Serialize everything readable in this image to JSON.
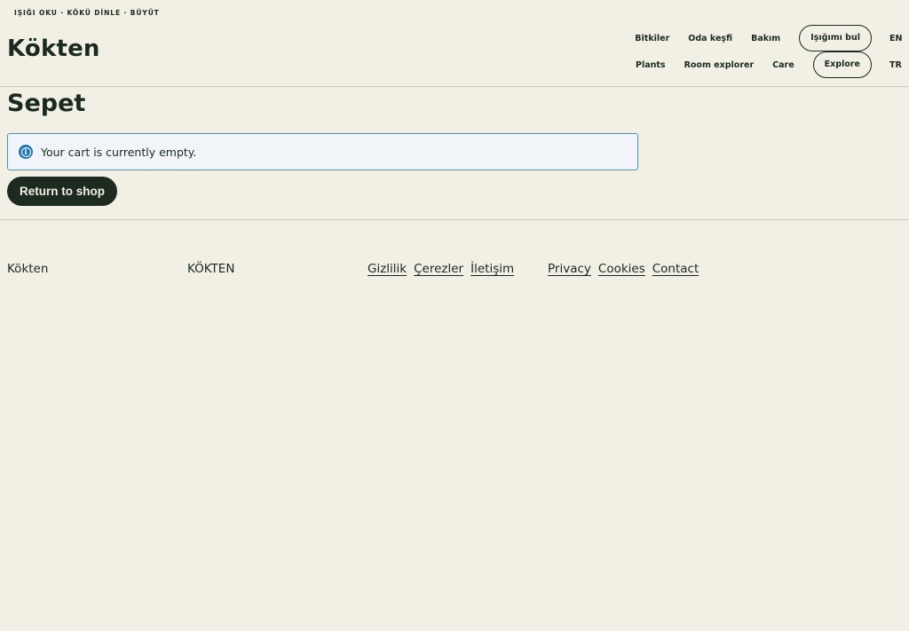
{
  "header": {
    "tagline": "IŞIĞI OKU · KÖKÜ DİNLE · BÜYÜT",
    "brand": "Kökten",
    "nav_tr": {
      "links": [
        "Bitkiler",
        "Oda keşfi",
        "Bakım"
      ],
      "pill": "Işığımı bul",
      "lang": "EN"
    },
    "nav_en": {
      "links": [
        "Plants",
        "Room explorer",
        "Care"
      ],
      "pill": "Explore",
      "lang": "TR"
    }
  },
  "main": {
    "title": "Sepet",
    "notice": {
      "icon": "info-icon",
      "text": "Your cart is currently empty."
    },
    "return_button": "Return to shop"
  },
  "footer": {
    "brand": "Kökten",
    "brand_caps": "KÖKTEN",
    "links_tr": [
      "Gizlilik",
      "Çerezler",
      "İletişim"
    ],
    "links_en": [
      "Privacy",
      "Cookies",
      "Contact"
    ]
  },
  "colors": {
    "background": "#f2efe4",
    "text": "#1b2a20",
    "button_bg": "#1c2a20",
    "info_border": "#4f8fb4",
    "info_bg": "#f1f5fa",
    "info_icon": "#1f78b4"
  }
}
